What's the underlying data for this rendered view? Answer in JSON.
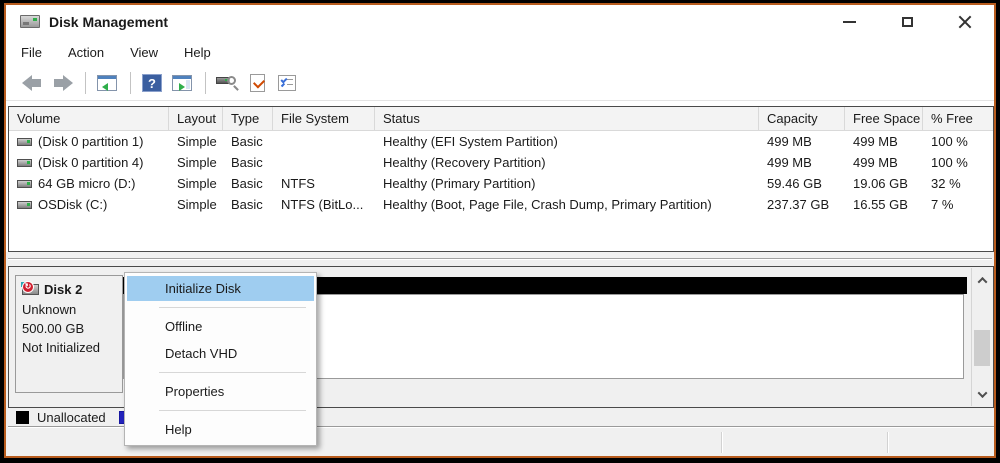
{
  "window": {
    "title": "Disk Management",
    "controls": [
      "minimize",
      "maximize",
      "close"
    ]
  },
  "menubar": {
    "items": [
      "File",
      "Action",
      "View",
      "Help"
    ]
  },
  "toolbar": {
    "icons": [
      "back",
      "forward",
      "show-console-tree",
      "help",
      "show-action-pane",
      "rescan-disks",
      "check-document",
      "checklist"
    ]
  },
  "volume_table": {
    "columns": [
      "Volume",
      "Layout",
      "Type",
      "File System",
      "Status",
      "Capacity",
      "Free Space",
      "% Free"
    ],
    "rows": [
      {
        "volume": "(Disk 0 partition 1)",
        "layout": "Simple",
        "type": "Basic",
        "file_system": "",
        "status": "Healthy (EFI System Partition)",
        "capacity": "499 MB",
        "free_space": "499 MB",
        "pct_free": "100 %"
      },
      {
        "volume": "(Disk 0 partition 4)",
        "layout": "Simple",
        "type": "Basic",
        "file_system": "",
        "status": "Healthy (Recovery Partition)",
        "capacity": "499 MB",
        "free_space": "499 MB",
        "pct_free": "100 %"
      },
      {
        "volume": "64 GB micro (D:)",
        "layout": "Simple",
        "type": "Basic",
        "file_system": "NTFS",
        "status": "Healthy (Primary Partition)",
        "capacity": "59.46 GB",
        "free_space": "19.06 GB",
        "pct_free": "32 %"
      },
      {
        "volume": "OSDisk (C:)",
        "layout": "Simple",
        "type": "Basic",
        "file_system": "NTFS (BitLo...",
        "status": "Healthy (Boot, Page File, Crash Dump, Primary Partition)",
        "capacity": "237.37 GB",
        "free_space": "16.55 GB",
        "pct_free": "7 %"
      }
    ]
  },
  "disk_panel": {
    "name": "Disk 2",
    "type": "Unknown",
    "size": "500.00 GB",
    "status": "Not Initialized"
  },
  "context_menu": {
    "items": [
      {
        "label": "Initialize Disk",
        "highlighted": true
      },
      {
        "label": "Offline",
        "highlighted": false
      },
      {
        "label": "Detach VHD",
        "highlighted": false
      },
      {
        "label": "Properties",
        "highlighted": false
      },
      {
        "label": "Help",
        "highlighted": false
      }
    ]
  },
  "legend": {
    "items": [
      {
        "label": "Unallocated",
        "color": "#000000"
      },
      {
        "label": "",
        "color": "#2424bd"
      }
    ]
  },
  "colors": {
    "menu_highlight": "#9fcdf0",
    "frame_border_orange": "#b85c1e",
    "unallocated_bar": "#000000",
    "legend_partition_blue": "#2424bd"
  }
}
